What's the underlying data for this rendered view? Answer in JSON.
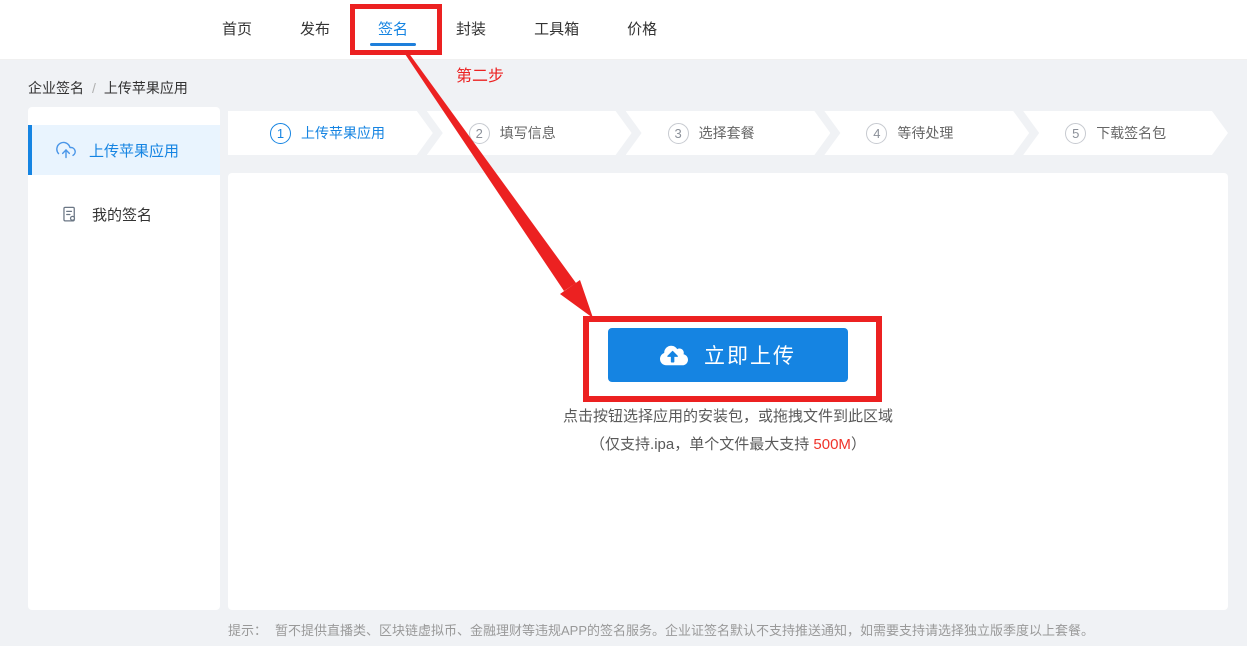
{
  "header": {
    "nav_items": [
      "首页",
      "发布",
      "签名",
      "封装",
      "工具箱",
      "价格"
    ],
    "active_item": "签名"
  },
  "breadcrumb": {
    "items": [
      "企业签名",
      "上传苹果应用"
    ],
    "separator": "/"
  },
  "sidebar": {
    "items": [
      {
        "label": "上传苹果应用",
        "icon": "cloud-upload-icon",
        "active": true
      },
      {
        "label": "我的签名",
        "icon": "signature-doc-icon",
        "active": false
      }
    ]
  },
  "steps": [
    {
      "num": "1",
      "label": "上传苹果应用",
      "active": true
    },
    {
      "num": "2",
      "label": "填写信息",
      "active": false
    },
    {
      "num": "3",
      "label": "选择套餐",
      "active": false
    },
    {
      "num": "4",
      "label": "等待处理",
      "active": false
    },
    {
      "num": "5",
      "label": "下载签名包",
      "active": false
    }
  ],
  "upload": {
    "button_label": "立即上传",
    "button_icon": "cloud-upload-icon",
    "hint_line1": "点击按钮选择应用的安装包，或拖拽文件到此区域",
    "hint_line2_prefix": "（仅支持.ipa，单个文件最大支持 ",
    "hint_line2_highlight": "500M",
    "hint_line2_suffix": "）"
  },
  "footer": {
    "tip_label": "提示：",
    "tip_text": "暂不提供直播类、区块链虚拟币、金融理财等违规APP的签名服务。企业证签名默认不支持推送通知，如需要支持请选择独立版季度以上套餐。"
  },
  "annotations": {
    "step_label": "第二步"
  },
  "colors": {
    "accent": "#1584e2",
    "accent_light_bg": "#e9f4fe",
    "annotation_red": "#ec2121",
    "highlight_red": "#f0332a",
    "page_bg": "#f0f2f5"
  }
}
